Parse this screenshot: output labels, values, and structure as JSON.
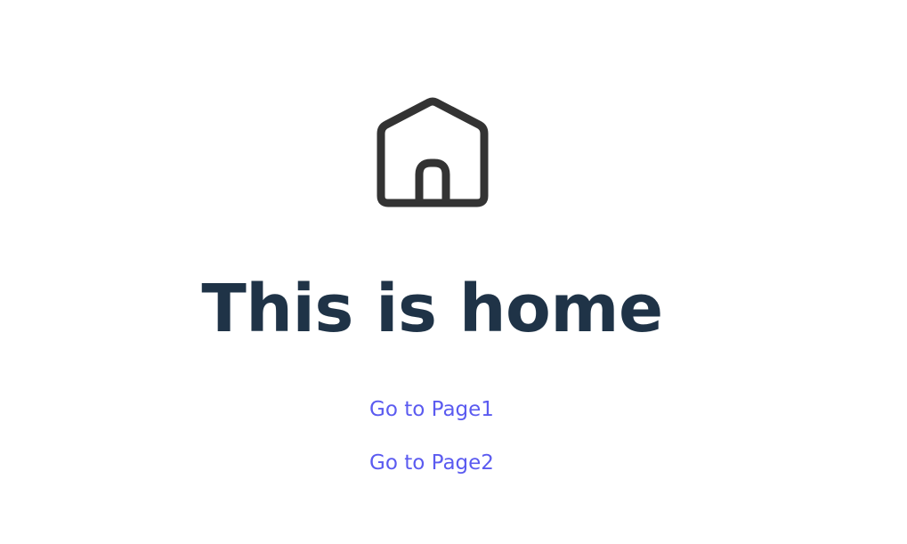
{
  "home": {
    "icon": "home-icon",
    "title": "This is home",
    "links": [
      {
        "label": "Go to Page1"
      },
      {
        "label": "Go to Page2"
      }
    ]
  },
  "colors": {
    "background": "#ffffff",
    "icon": "#333333",
    "title": "#1f3347",
    "link": "#5b5bf0"
  }
}
